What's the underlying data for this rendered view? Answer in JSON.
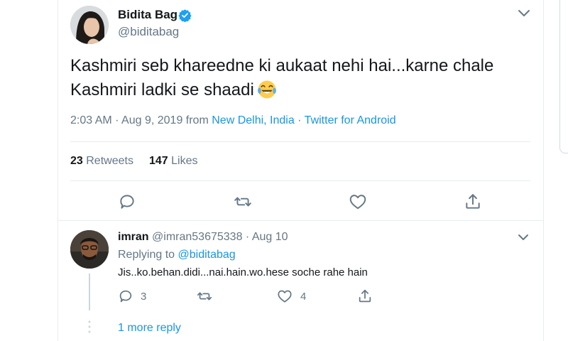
{
  "tweet": {
    "author_name": "Bidita Bag",
    "author_handle": "@biditabag",
    "text": "Kashmiri seb khareedne ki aukaat nehi hai...karne chale Kashmiri ladki se shaadi",
    "time_date": "2:03 AM · Aug 9, 2019 from ",
    "location": "New Delhi, India",
    "separator": " · ",
    "source": "Twitter for Android",
    "retweets_count": "23",
    "retweets_label": "Retweets",
    "likes_count": "147",
    "likes_label": "Likes",
    "icons": [
      "verified-badge-icon",
      "chevron-down-icon",
      "face-with-tears-of-joy-emoji",
      "reply-icon",
      "retweet-icon",
      "like-icon",
      "share-icon"
    ]
  },
  "reply": {
    "author_name": "imran",
    "author_handle": "@imran53675338",
    "separator": " · ",
    "date": "Aug 10",
    "replying_prefix": "Replying to ",
    "replying_to": "@biditabag",
    "text": "Jis..ko.behan.didi...nai.hain.wo.hese soche rahe hain",
    "reply_count": "3",
    "like_count": "4",
    "more_replies_label": "1 more reply"
  },
  "colors": {
    "accent": "#1b95e0",
    "secondary_text": "#657786",
    "primary_text": "#14171a",
    "divider": "#e6ecf0",
    "verified": "#1da1f2"
  }
}
